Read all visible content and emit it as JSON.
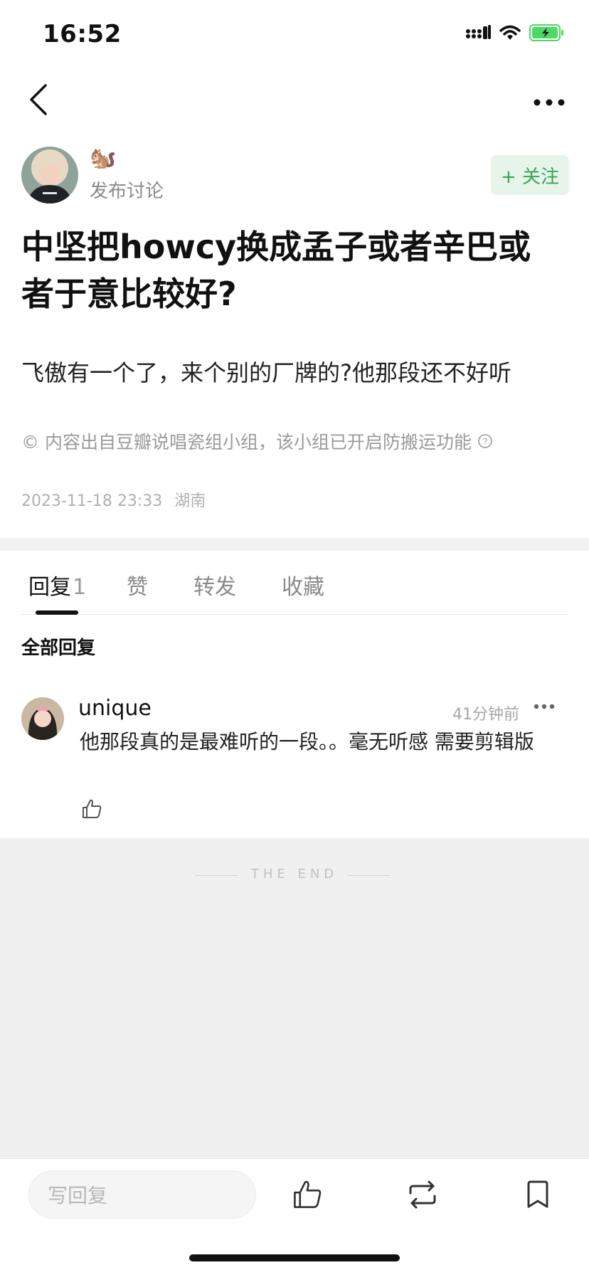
{
  "status_bar": {
    "time": "16:52"
  },
  "author": {
    "emoji": "🐿️",
    "action": "发布讨论",
    "follow_label": "+ 关注"
  },
  "post": {
    "title": "中坚把howcy换成孟子或者辛巴或者于意比较好?",
    "body": "飞傲有一个了，来个别的厂牌的?他那段还不好听",
    "notice": "© 内容出自豆瓣说唱瓷组小组，该小组已开启防搬运功能",
    "datetime": "2023-11-18 23:33",
    "location": "湖南"
  },
  "tabs": [
    {
      "label": "回复",
      "count": "1"
    },
    {
      "label": "赞"
    },
    {
      "label": "转发"
    },
    {
      "label": "收藏"
    }
  ],
  "replies_header": "全部回复",
  "comment": {
    "user": "unique",
    "time": "41分钟前",
    "text": "他那段真的是最难听的一段。。毫无听感 需要剪辑版"
  },
  "end_text": "THE END",
  "bottom_bar": {
    "reply_placeholder": "写回复"
  },
  "colors": {
    "accent_green": "#3aa45a",
    "follow_bg": "#e6f4ea",
    "battery": "#4cd964"
  }
}
